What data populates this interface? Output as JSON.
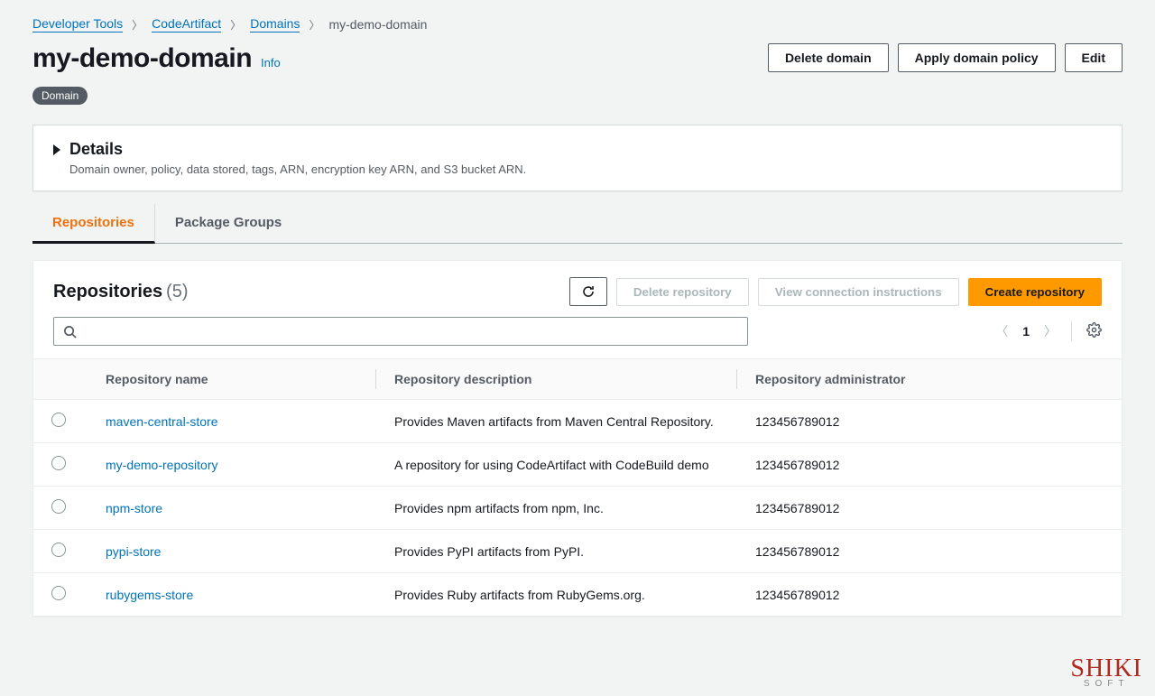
{
  "breadcrumb": {
    "items": [
      "Developer Tools",
      "CodeArtifact",
      "Domains"
    ],
    "current": "my-demo-domain"
  },
  "header": {
    "title": "my-demo-domain",
    "info": "Info",
    "badge": "Domain",
    "buttons": {
      "delete": "Delete domain",
      "apply_policy": "Apply domain policy",
      "edit": "Edit"
    }
  },
  "details": {
    "title": "Details",
    "subtitle": "Domain owner, policy, data stored, tags, ARN, encryption key ARN, and S3 bucket ARN."
  },
  "tabs": {
    "repositories": "Repositories",
    "package_groups": "Package Groups"
  },
  "repos": {
    "title": "Repositories",
    "count": "(5)",
    "actions": {
      "delete": "Delete repository",
      "view_conn": "View connection instructions",
      "create": "Create repository"
    },
    "search_placeholder": "",
    "page": "1",
    "columns": {
      "name": "Repository name",
      "desc": "Repository description",
      "admin": "Repository administrator"
    },
    "rows": [
      {
        "name": "maven-central-store",
        "desc": "Provides Maven artifacts from Maven Central Repository.",
        "admin": "123456789012"
      },
      {
        "name": "my-demo-repository",
        "desc": "A repository for using CodeArtifact with CodeBuild demo",
        "admin": "123456789012"
      },
      {
        "name": "npm-store",
        "desc": "Provides npm artifacts from npm, Inc.",
        "admin": "123456789012"
      },
      {
        "name": "pypi-store",
        "desc": "Provides PyPI artifacts from PyPI.",
        "admin": "123456789012"
      },
      {
        "name": "rubygems-store",
        "desc": "Provides Ruby artifacts from RubyGems.org.",
        "admin": "123456789012"
      }
    ]
  },
  "watermark": {
    "brand": "SHIKI",
    "sub": "SOFT"
  }
}
